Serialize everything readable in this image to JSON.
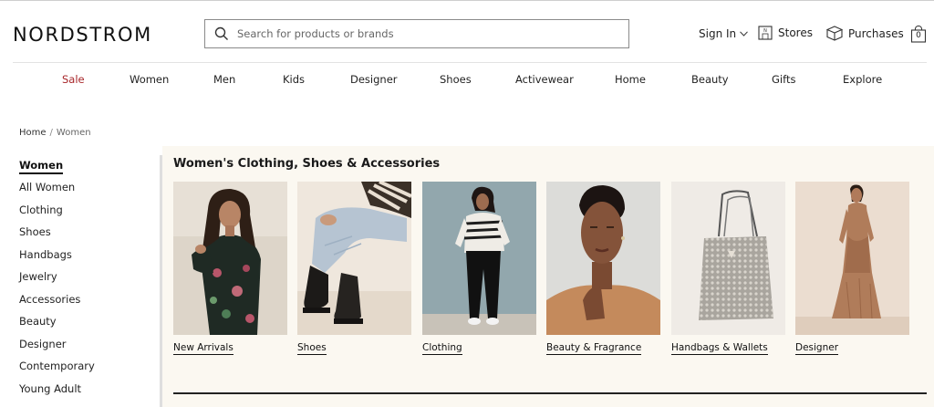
{
  "header": {
    "logo": "NORDSTROM",
    "search": {
      "placeholder": "Search for products or brands",
      "value": ""
    },
    "sign_in": "Sign In",
    "stores": "Stores",
    "purchases": "Purchases",
    "bag_count": "0"
  },
  "nav": {
    "items": [
      "Sale",
      "Women",
      "Men",
      "Kids",
      "Designer",
      "Shoes",
      "Activewear",
      "Home",
      "Beauty",
      "Gifts",
      "Explore"
    ],
    "sale_color": "#a8262a"
  },
  "breadcrumb": {
    "home": "Home",
    "separator": "/",
    "current": "Women"
  },
  "sidebar": {
    "title": "Women",
    "items": [
      "All Women",
      "Clothing",
      "Shoes",
      "Handbags",
      "Jewelry",
      "Accessories",
      "Beauty",
      "Designer",
      "Contemporary",
      "Young Adult"
    ]
  },
  "content": {
    "title": "Women's Clothing, Shoes & Accessories",
    "categories": [
      {
        "label": "New Arrivals",
        "image_icon": "model-floral-dress-photo"
      },
      {
        "label": "Shoes",
        "image_icon": "boots-and-jeans-photo"
      },
      {
        "label": "Clothing",
        "image_icon": "model-striped-sweater-photo"
      },
      {
        "label": "Beauty & Fragrance",
        "image_icon": "model-portrait-photo"
      },
      {
        "label": "Handbags & Wallets",
        "image_icon": "sequin-bag-photo"
      },
      {
        "label": "Designer",
        "image_icon": "model-satin-gown-photo"
      }
    ]
  },
  "colors": {
    "panel_background": "#fbf8f1",
    "text": "#1a1a1a"
  }
}
